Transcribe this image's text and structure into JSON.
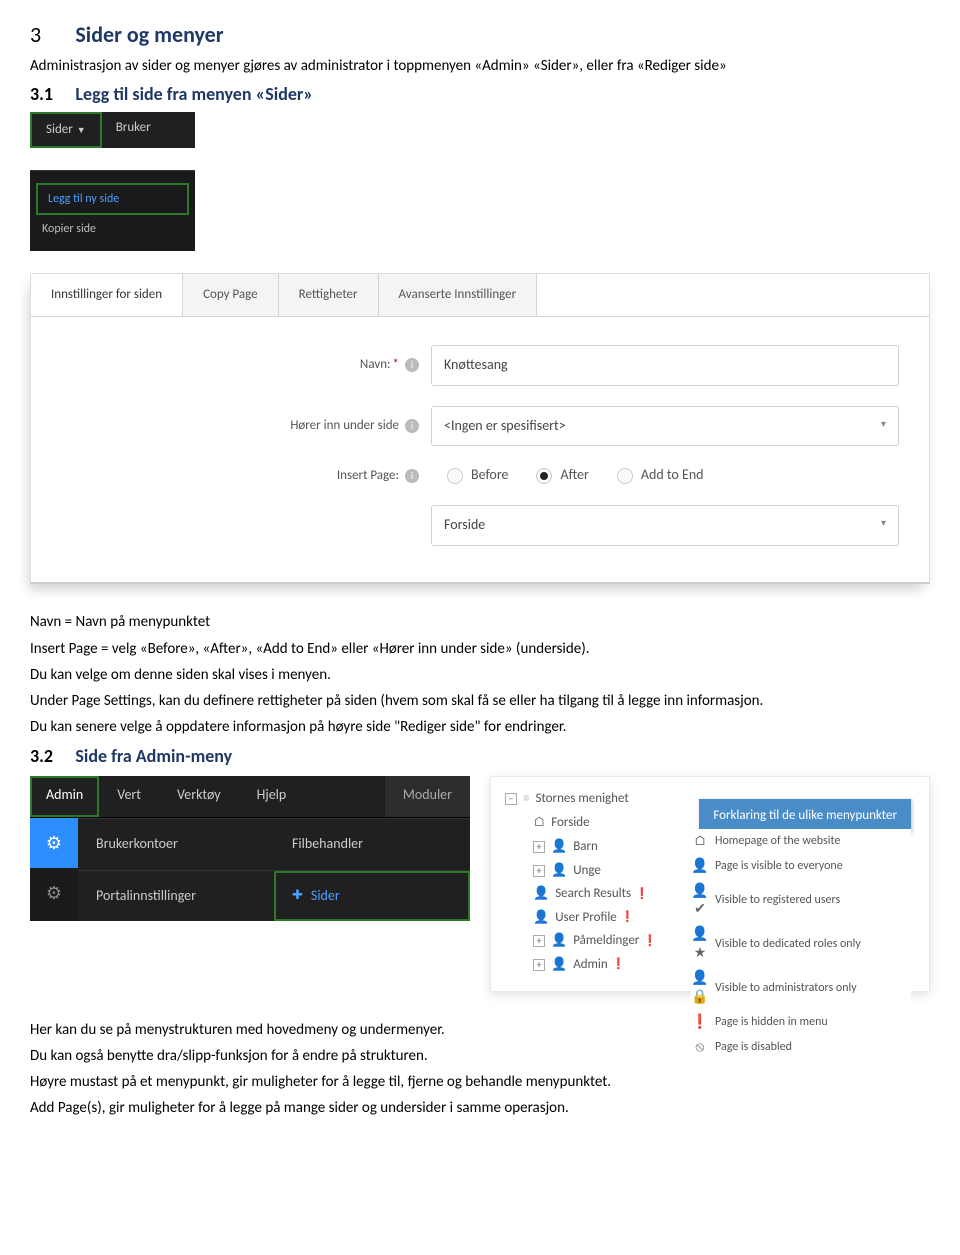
{
  "heading1": {
    "num": "3",
    "text": "Sider og menyer"
  },
  "intro": "Administrasjon av sider og menyer gjøres av administrator i toppmenyen «Admin» «Sider», eller fra «Rediger side»",
  "heading2a": {
    "num": "3.1",
    "text": "Legg til side fra menyen «Sider»"
  },
  "topmenu": {
    "sider": "Sider",
    "bruker": "Bruker"
  },
  "popup": {
    "legg_til": "Legg til ny side",
    "kopier": "Kopier side"
  },
  "settings": {
    "tabs": {
      "t1": "Innstillinger for siden",
      "t2": "Copy Page",
      "t3": "Rettigheter",
      "t4": "Avanserte Innstillinger"
    },
    "navn_label": "Navn:",
    "navn_value": "Knøttesang",
    "under_label": "Hører inn under side",
    "under_value": "<Ingen er spesifisert>",
    "insert_label": "Insert Page:",
    "radio": {
      "before": "Before",
      "after": "After",
      "end": "Add to End"
    },
    "forside": "Forside"
  },
  "para1": "Navn = Navn på menypunktet",
  "para2": "Insert Page = velg «Before», «After», «Add to End» eller «Hører inn under side» (underside).",
  "para3": "Du kan velge om denne siden skal vises i menyen.",
  "para4": "Under Page Settings, kan du definere rettigheter på siden (hvem som skal få se eller ha tilgang til å legge inn informasjon.",
  "para5": "Du kan senere velge å oppdatere informasjon på høyre side \"Rediger side\" for endringer.",
  "heading2b": {
    "num": "3.2",
    "text": "Side fra Admin-meny"
  },
  "admin": {
    "top": {
      "admin": "Admin",
      "vert": "Vert",
      "verktoy": "Verktøy",
      "hjelp": "Hjelp",
      "moduler": "Moduler"
    },
    "row1": {
      "a": "Brukerkontoer",
      "b": "Filbehandler"
    },
    "row2": {
      "a": "Portalinnstillinger",
      "b": "Sider"
    }
  },
  "banner": "Forklaring til de ulike menypunkter",
  "tree": {
    "root": "Stornes menighet",
    "items": [
      "Forside",
      "Barn",
      "Unge",
      "Search Results",
      "User Profile",
      "Påmeldinger",
      "Admin"
    ]
  },
  "legend": {
    "l1": "Homepage of the website",
    "l2": "Page is visible to everyone",
    "l3": "Visible to registered users",
    "l4": "Visible to dedicated roles only",
    "l5": "Visible to administrators only",
    "l6": "Page is hidden in menu",
    "l7": "Page is disabled"
  },
  "foot1": "Her kan du se på menystrukturen med hovedmeny og undermenyer.",
  "foot2": "Du kan også benytte dra/slipp-funksjon for å endre på strukturen.",
  "foot3": "Høyre mustast på et menypunkt, gir muligheter for å legge til, fjerne og behandle menypunktet.",
  "foot4": "Add Page(s), gir muligheter for å legge på mange sider og undersider i samme operasjon."
}
